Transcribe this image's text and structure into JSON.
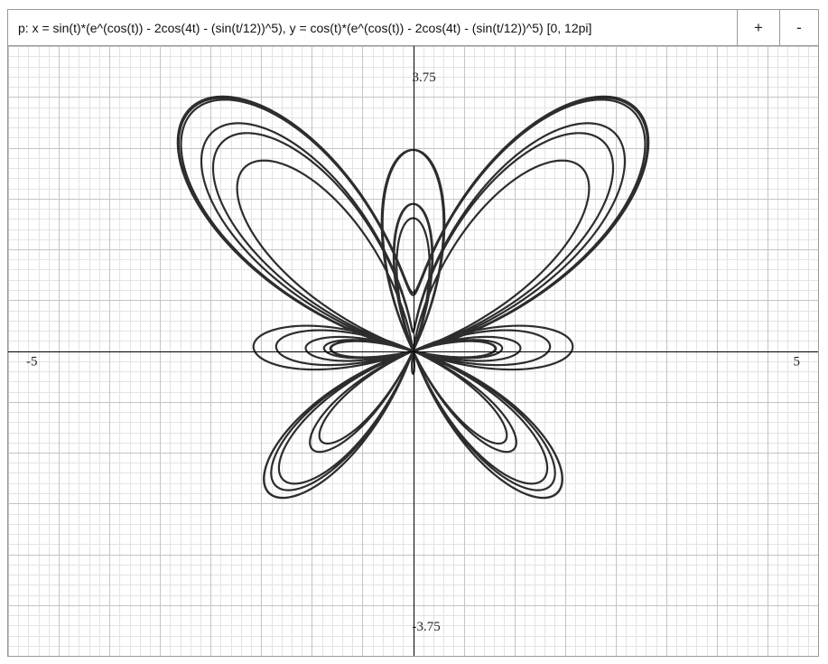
{
  "toolbar": {
    "formula": "p: x = sin(t)*(e^(cos(t)) - 2cos(4t) - (sin(t/12))^5), y = cos(t)*(e^(cos(t)) - 2cos(4t) - (sin(t/12))^5) [0, 12pi]",
    "zoom_in_label": "+",
    "zoom_out_label": "-"
  },
  "chart_data": {
    "type": "line",
    "title": "",
    "xlabel": "",
    "ylabel": "",
    "xlim": [
      -5,
      5
    ],
    "ylim": [
      -3.75,
      3.75
    ],
    "tick_labels": {
      "x_min": "-5",
      "x_max": "5",
      "y_max": "3.75",
      "y_min": "-3.75"
    },
    "grid": true,
    "grid_minor_step": 0.125,
    "grid_major_step": 0.625,
    "colors": {
      "curve": "#000000",
      "axis": "#000000",
      "grid_minor": "#e3e3e3",
      "grid_major": "#c4c4c4"
    },
    "series": [
      {
        "parametric": true,
        "x_expr": "sin(t)*(e^(cos(t)) - 2cos(4t) - (sin(t/12))^5)",
        "y_expr": "cos(t)*(e^(cos(t)) - 2cos(4t) - (sin(t/12))^5)",
        "t_range": [
          0,
          37.699111843
        ],
        "samples": 6000
      }
    ]
  }
}
